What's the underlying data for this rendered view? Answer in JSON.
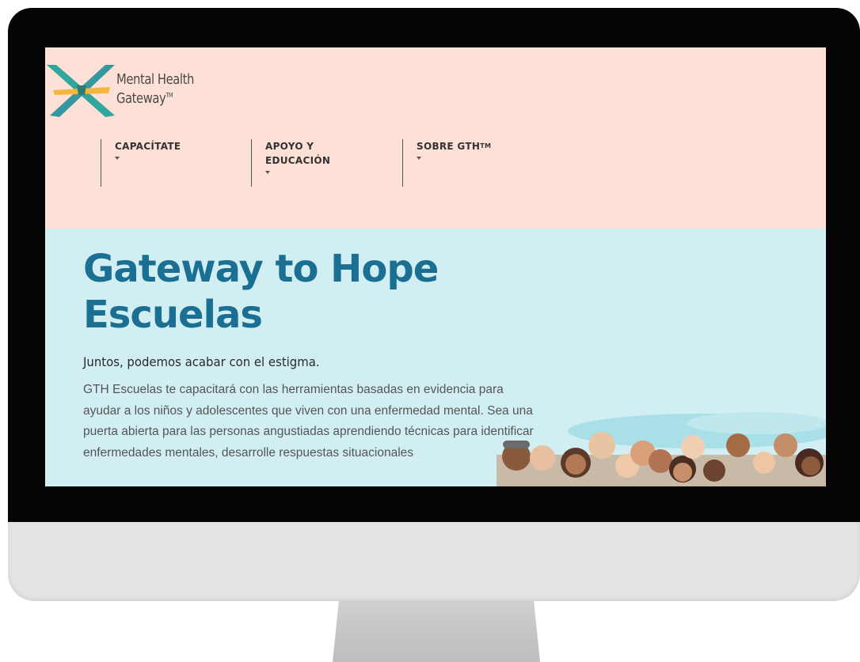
{
  "logo": {
    "line1": "Mental Health",
    "line2": "Gateway",
    "tm": "TM"
  },
  "nav": [
    {
      "label": "CAPACÍTATE"
    },
    {
      "label": "APOYO Y\nEDUCACIÓN"
    },
    {
      "label": "SOBRE GTH",
      "sup": "TM"
    }
  ],
  "hero": {
    "title_line1": "Gateway to Hope",
    "title_line2": "Escuelas",
    "tagline": "Juntos, podemos acabar con el estigma.",
    "body": "GTH Escuelas te capacitará con las herramientas basadas en evidencia para ayudar a los niños y adolescentes que viven con una enfermedad mental. Sea una puerta abierta para las personas angustiadas aprendiendo técnicas para identificar enfermedades mentales, desarrolle respuestas situacionales"
  },
  "colors": {
    "header_bg": "#fde0d6",
    "hero_bg": "#d1eff3",
    "title": "#1a6f93",
    "logo_teal": "#2fa79f",
    "logo_orange": "#f4b63c"
  }
}
